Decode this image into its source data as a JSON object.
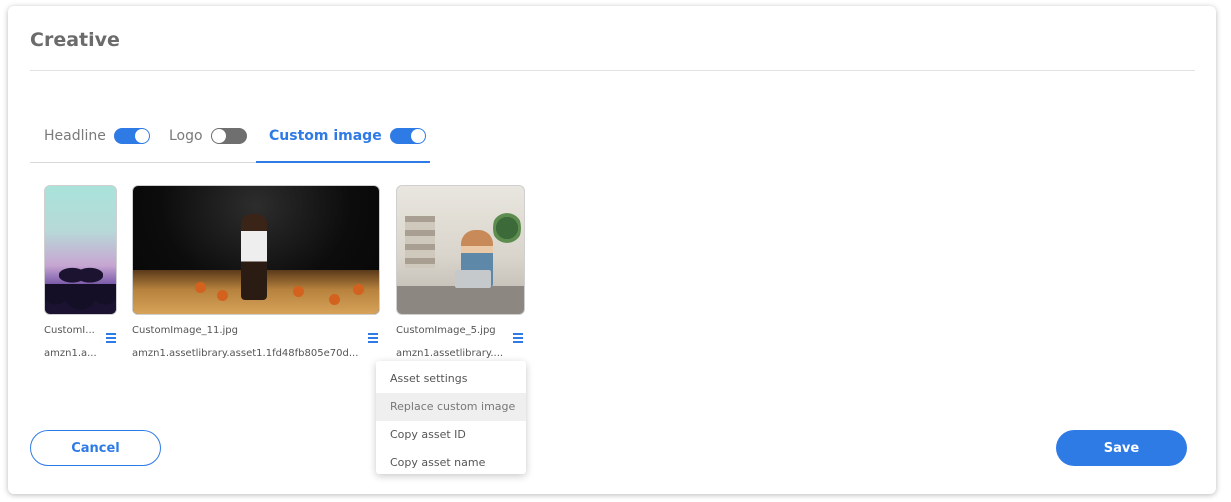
{
  "panel": {
    "title": "Creative"
  },
  "tabs": [
    {
      "label": "Headline",
      "toggle": "on",
      "active": false
    },
    {
      "label": "Logo",
      "toggle": "off",
      "active": false
    },
    {
      "label": "Custom image",
      "toggle": "on",
      "active": true
    }
  ],
  "assets": [
    {
      "name": "CustomI...",
      "id": "amzn1.a..."
    },
    {
      "name": "CustomImage_11.jpg",
      "id": "amzn1.assetlibrary.asset1.1fd48fb805e70d..."
    },
    {
      "name": "CustomImage_5.jpg",
      "id": "amzn1.assetlibrary...."
    }
  ],
  "asset_menu": {
    "items": [
      "Asset settings",
      "Replace custom image",
      "Copy asset ID",
      "Copy asset name"
    ]
  },
  "footer": {
    "cancel_label": "Cancel",
    "save_label": "Save"
  },
  "colors": {
    "accent": "#2f7be6",
    "toggle_off": "#6f6f6f"
  }
}
